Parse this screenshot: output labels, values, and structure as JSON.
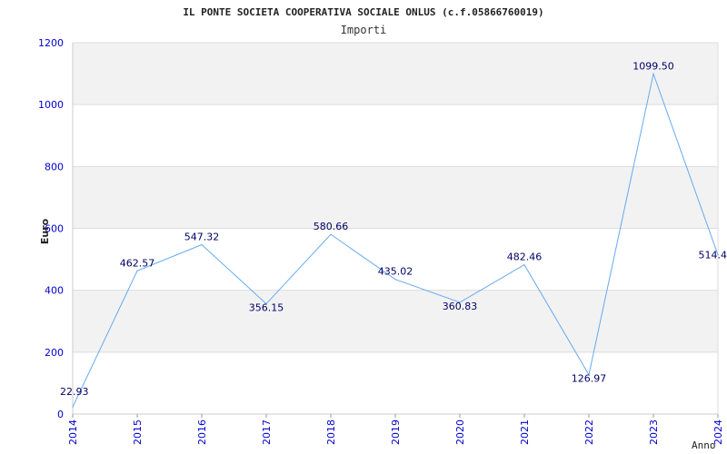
{
  "chart_data": {
    "type": "line",
    "title": "IL PONTE SOCIETA COOPERATIVA SOCIALE ONLUS (c.f.05866760019)",
    "subtitle": "Importi",
    "xlabel": "Anno",
    "ylabel": "Euro",
    "ylim": [
      0,
      1200
    ],
    "yticks": [
      "0",
      "200",
      "400",
      "600",
      "800",
      "1000",
      "1200"
    ],
    "grid": true,
    "x": [
      "2014",
      "2015",
      "2016",
      "2017",
      "2018",
      "2019",
      "2020",
      "2021",
      "2022",
      "2023",
      "2024"
    ],
    "values": [
      22.93,
      462.57,
      547.32,
      356.15,
      580.66,
      435.02,
      360.83,
      482.46,
      126.97,
      1099.5,
      514.4
    ],
    "labels": [
      "22.93",
      "462.57",
      "547.32",
      "356.15",
      "580.66",
      "435.02",
      "360.83",
      "482.46",
      "126.97",
      "1099.50",
      "514.4"
    ],
    "colors": {
      "line": "#66aaee",
      "band": "#f2f2f2",
      "tick": "#0000cc"
    }
  }
}
